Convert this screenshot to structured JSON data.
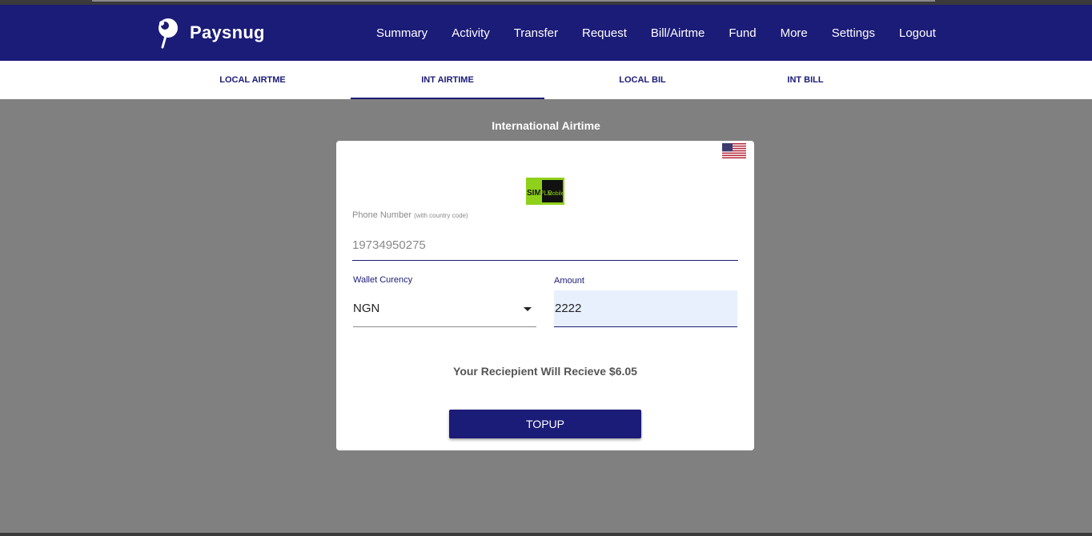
{
  "brand": {
    "name": "Paysnug",
    "logo_icon": "pin-logo-icon"
  },
  "nav": [
    {
      "label": "Summary"
    },
    {
      "label": "Activity"
    },
    {
      "label": "Transfer"
    },
    {
      "label": "Request"
    },
    {
      "label": "Bill/Airtme"
    },
    {
      "label": "Fund"
    },
    {
      "label": "More"
    },
    {
      "label": "Settings"
    },
    {
      "label": "Logout"
    }
  ],
  "tabs": [
    {
      "label": "LOCAL AIRTME",
      "active": false
    },
    {
      "label": "INT AIRTIME",
      "active": true
    },
    {
      "label": "LOCAL BIL",
      "active": false
    },
    {
      "label": "INT BILL",
      "active": false
    }
  ],
  "section": {
    "title": "International Airtime"
  },
  "form": {
    "flag_icon": "us-flag-icon",
    "operator_logo": {
      "text_left": "SIM",
      "text_mid": "PLE",
      "text_right": "Mobile"
    },
    "phone": {
      "label": "Phone Number",
      "hint": "(with country code)",
      "value": "19734950275"
    },
    "wallet": {
      "label": "Wallet Curency",
      "value": "NGN"
    },
    "amount": {
      "label": "Amount",
      "value": "2222"
    },
    "receive_text": "Your Reciepient Will Recieve $6.05",
    "submit_label": "TOPUP"
  },
  "colors": {
    "primary": "#1b1b78",
    "background": "#808080",
    "autofill": "#e8f0fe"
  }
}
